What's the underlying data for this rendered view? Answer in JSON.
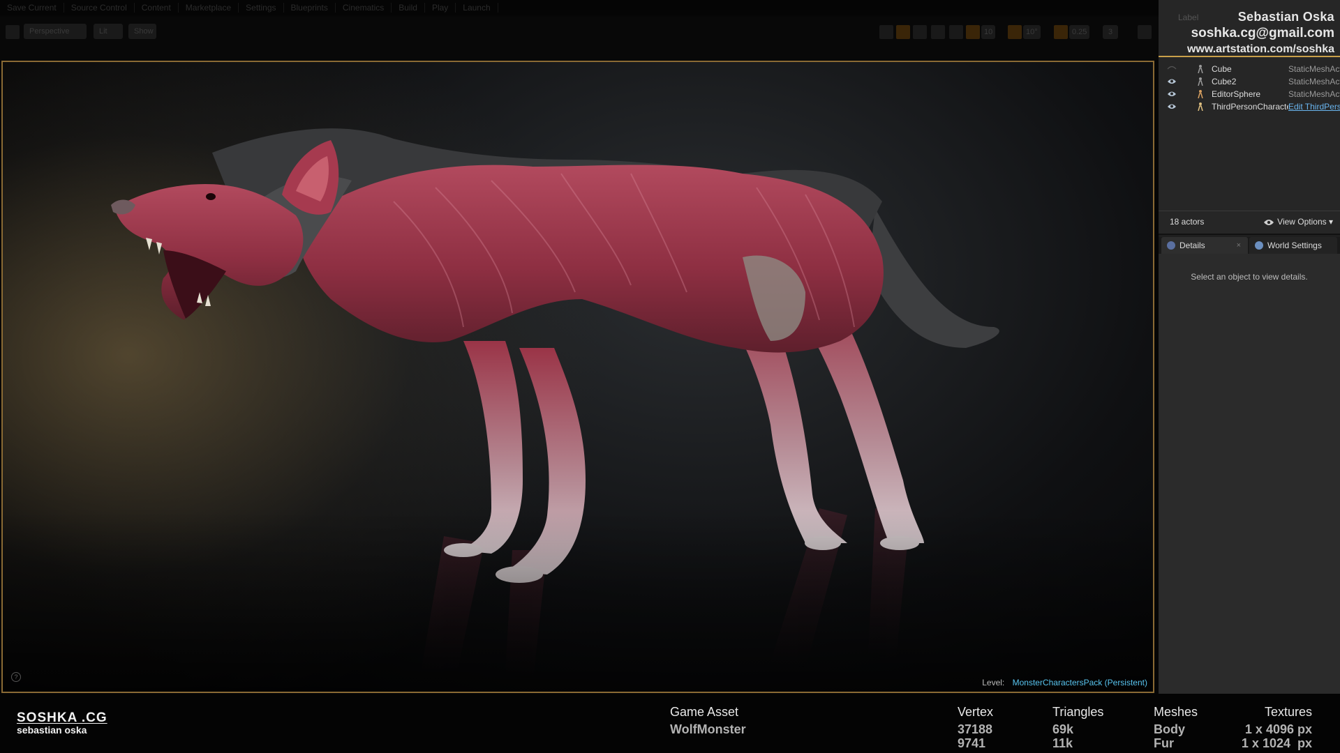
{
  "menu": {
    "items": [
      "Save Current",
      "Source Control",
      "Content",
      "Marketplace",
      "Settings",
      "Blueprints",
      "Cinematics",
      "Build",
      "Play",
      "Launch"
    ]
  },
  "viewport_toolbar": {
    "perspective_label": "Perspective",
    "lit_label": "Lit",
    "show_label": "Show",
    "grid_snap": "10",
    "angle_snap": "10°",
    "scale_snap": "0.25",
    "camera_speed": "3"
  },
  "viewport": {
    "level_prefix": "Level:",
    "level_name": "MonsterCharactersPack (Persistent)",
    "help_glyph": "?"
  },
  "signature": {
    "name": "Sebastian Oska",
    "email": "soshka.cg@gmail.com",
    "site": "www.artstation.com/soshka"
  },
  "outliner": {
    "column_label": "Label",
    "actors": [
      {
        "name": "Cube",
        "type": "StaticMeshActor",
        "link": false
      },
      {
        "name": "Cube2",
        "type": "StaticMeshActor",
        "link": false
      },
      {
        "name": "EditorSphere",
        "type": "StaticMeshActor",
        "link": false
      },
      {
        "name": "ThirdPersonCharacter",
        "type": "Edit ThirdPersonCharacter",
        "link": true
      }
    ],
    "actor_count": "18 actors",
    "view_options_label": "View Options"
  },
  "details": {
    "tab_details": "Details",
    "tab_close": "×",
    "tab_world": "World Settings",
    "empty_message": "Select an object to view details."
  },
  "info": {
    "brand_top": "SOSHKA .CG",
    "brand_bottom": "sebastian oska",
    "asset_header": "Game Asset",
    "asset_name": "WolfMonster",
    "vertex_header": "Vertex",
    "vertex_values": [
      "37188",
      "9741"
    ],
    "triangles_header": "Triangles",
    "triangles_values": [
      "69k",
      "11k"
    ],
    "meshes_header": "Meshes",
    "meshes_values": [
      "Body",
      "Fur"
    ],
    "textures_header": "Textures",
    "textures_values": [
      "1 x 4096 px",
      "1 x 1024  px"
    ]
  },
  "colors": {
    "viewport_border": "#8a6a34",
    "link": "#58c4ef",
    "flesh": "#9c3a4e",
    "fur": "#3a3b3c"
  }
}
